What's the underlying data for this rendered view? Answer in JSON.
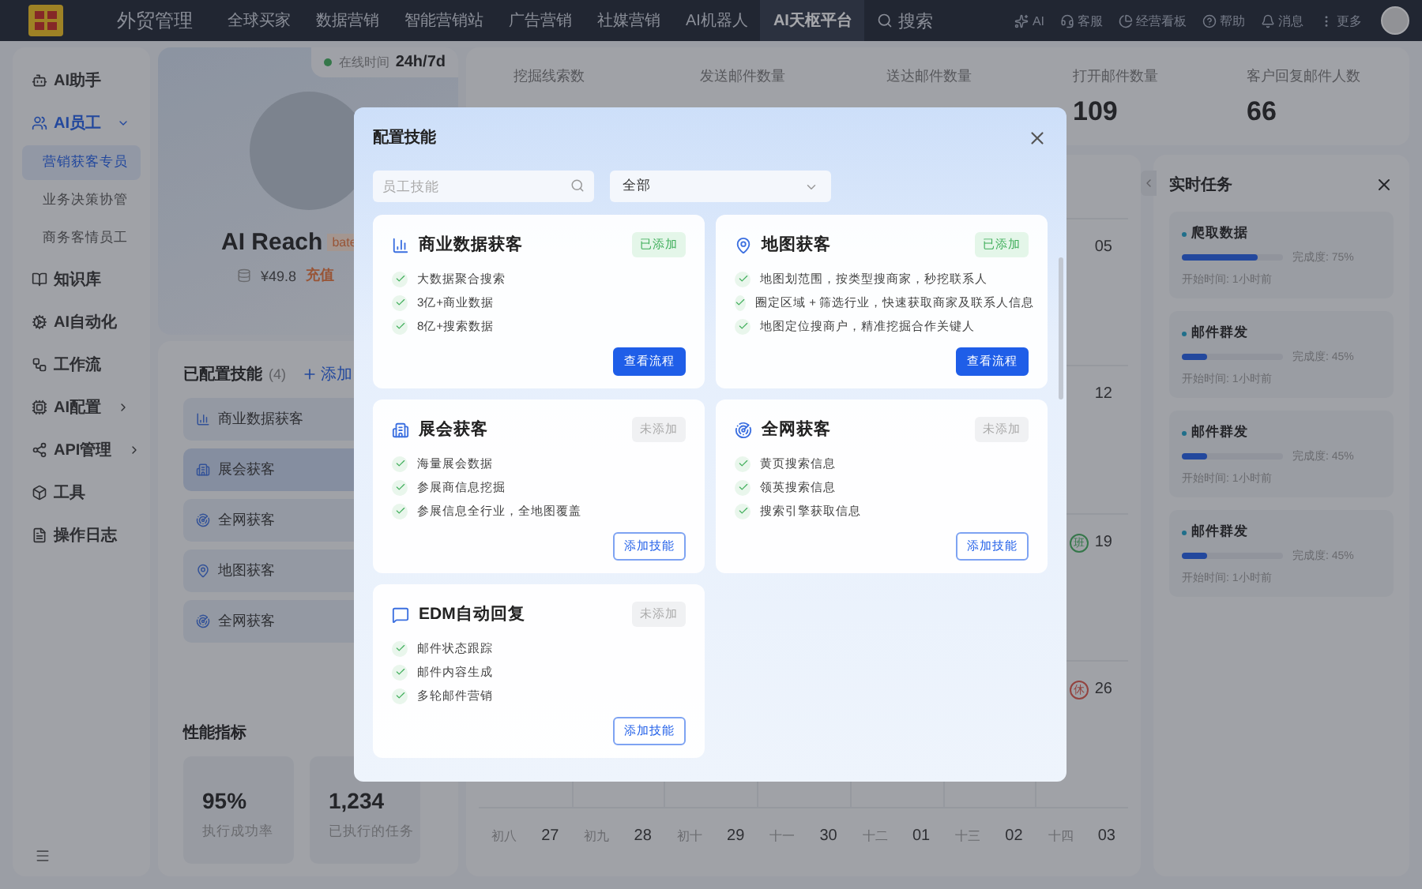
{
  "topbar": {
    "nav": [
      {
        "label": "外贸管理",
        "selected": false
      },
      {
        "label": "全球买家",
        "selected": false
      },
      {
        "label": "数据营销",
        "selected": false
      },
      {
        "label": "智能营销站",
        "selected": false
      },
      {
        "label": "广告营销",
        "selected": false
      },
      {
        "label": "社媒营销",
        "selected": false
      },
      {
        "label": "AI机器人",
        "selected": false
      },
      {
        "label": "AI天枢平台",
        "selected": true
      }
    ],
    "search": "搜索",
    "tools": [
      "AI",
      "客服",
      "经营看板",
      "帮助",
      "消息",
      "更多"
    ]
  },
  "sidebar": {
    "items": [
      {
        "label": "AI助手",
        "kind": "link"
      },
      {
        "label": "AI员工",
        "kind": "group",
        "expanded": true,
        "children": [
          {
            "label": "营销获客专员",
            "selected": true
          },
          {
            "label": "业务决策协管",
            "selected": false
          },
          {
            "label": "商务客情员工",
            "selected": false
          }
        ]
      },
      {
        "label": "知识库",
        "kind": "link"
      },
      {
        "label": "AI自动化",
        "kind": "link"
      },
      {
        "label": "工作流",
        "kind": "link"
      },
      {
        "label": "AI配置",
        "kind": "group",
        "expanded": false
      },
      {
        "label": "API管理",
        "kind": "group",
        "expanded": false
      },
      {
        "label": "工具",
        "kind": "link"
      },
      {
        "label": "操作日志",
        "kind": "link"
      }
    ]
  },
  "profile": {
    "online_label": "在线时间",
    "online_value": "24h/7d",
    "name": "AI Reach",
    "tag": "bate",
    "balance": "¥49.8",
    "recharge": "充值"
  },
  "configured": {
    "title": "已配置技能",
    "count": "(4)",
    "add": "添加",
    "items": [
      {
        "label": "商业数据获客",
        "selected": false
      },
      {
        "label": "展会获客",
        "selected": true
      },
      {
        "label": "全网获客",
        "selected": false
      },
      {
        "label": "地图获客",
        "selected": false
      },
      {
        "label": "全网获客",
        "selected": false
      }
    ]
  },
  "performance": {
    "title": "性能指标",
    "metrics": [
      {
        "value": "95%",
        "label": "执行成功率"
      },
      {
        "value": "1,234",
        "label": "已执行的任务"
      }
    ]
  },
  "stats": [
    {
      "label": "挖掘线索数"
    },
    {
      "label": "发送邮件数量"
    },
    {
      "label": "送达邮件数量"
    },
    {
      "label": "打开邮件数量",
      "value": "109"
    },
    {
      "label": "客户回复邮件人数",
      "value": "66"
    }
  ],
  "calendar": {
    "last_column": [
      {
        "day": "05"
      },
      {
        "day": "12"
      },
      {
        "day": "19",
        "badge": "班",
        "color": "#35774a"
      },
      {
        "day": "26",
        "badge": "休",
        "color": "#93433f"
      }
    ],
    "bottom_row": [
      {
        "lunar": "初八",
        "day": "27"
      },
      {
        "lunar": "初九",
        "day": "28"
      },
      {
        "lunar": "初十",
        "day": "29"
      },
      {
        "lunar": "十一",
        "day": "30"
      },
      {
        "lunar": "十二",
        "day": "01"
      },
      {
        "lunar": "十三",
        "day": "02"
      },
      {
        "lunar": "十四",
        "day": "03"
      }
    ]
  },
  "tasks": {
    "title": "实时任务",
    "items": [
      {
        "name": "爬取数据",
        "level": 0.75,
        "progress": "完成度: 75%",
        "start": "开始时间: 1小时前"
      },
      {
        "name": "邮件群发",
        "level": 0.25,
        "progress": "完成度: 45%",
        "start": "开始时间: 1小时前"
      },
      {
        "name": "邮件群发",
        "level": 0.25,
        "progress": "完成度: 45%",
        "start": "开始时间: 1小时前"
      },
      {
        "name": "邮件群发",
        "level": 0.25,
        "progress": "完成度: 45%",
        "start": "开始时间: 1小时前"
      }
    ]
  },
  "modal": {
    "title": "配置技能",
    "search": {
      "placeholder": "员工技能"
    },
    "filter": "全部",
    "skills": [
      {
        "title": "商业数据获客",
        "added": true,
        "status": "已添加",
        "features": [
          "大数据聚合搜索",
          "3亿+商业数据",
          "8亿+搜索数据"
        ],
        "action": "查看流程"
      },
      {
        "title": "地图获客",
        "added": true,
        "status": "已添加",
        "features": [
          "地图划范围，按类型搜商家，秒挖联系人",
          "圈定区域 + 筛选行业，快速获取商家及联系人信息",
          "地图定位搜商户，精准挖掘合作关键人"
        ],
        "action": "查看流程"
      },
      {
        "title": "展会获客",
        "added": false,
        "status": "未添加",
        "features": [
          "海量展会数据",
          "参展商信息挖掘",
          "参展信息全行业，全地图覆盖"
        ],
        "action": "添加技能"
      },
      {
        "title": "全网获客",
        "added": false,
        "status": "未添加",
        "features": [
          "黄页搜索信息",
          "领英搜索信息",
          "搜索引擎获取信息"
        ],
        "action": "添加技能"
      },
      {
        "title": "EDM自动回复",
        "added": false,
        "status": "未添加",
        "features": [
          "邮件状态跟踪",
          "邮件内容生成",
          "多轮邮件营销"
        ],
        "action": "添加技能"
      }
    ]
  }
}
